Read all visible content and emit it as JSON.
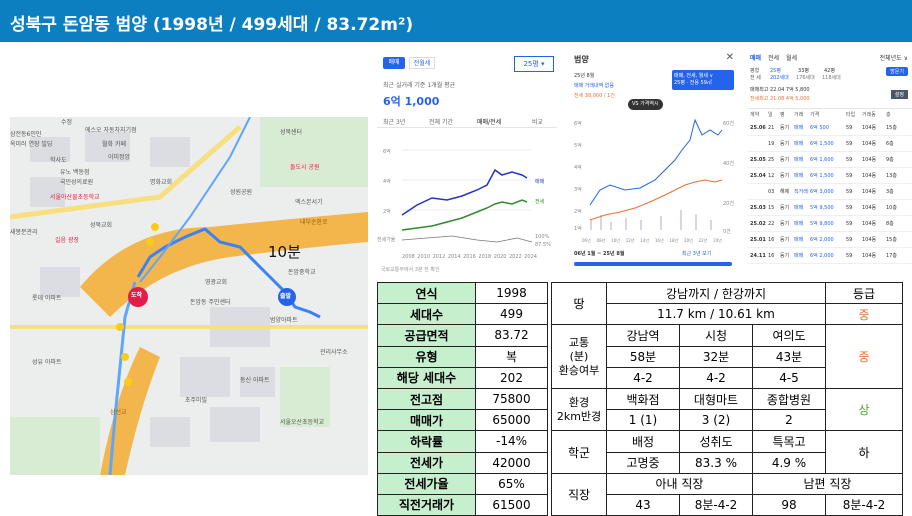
{
  "title": "성북구 돈암동 범양 (1998년 / 499세대 / 83.72m²)",
  "map": {
    "travel_time": "10분",
    "labels": [
      "수정",
      "에스오 자동차지기점",
      "삼전동6인민",
      "옥미러 연장 빌딩",
      "월화 카페",
      "학사도",
      "이미정앙",
      "유노 백동점",
      "국민성의료원",
      "서울아산물초등학교",
      "성북교회",
      "명화교회",
      "성북센터",
      "돌도시 공원",
      "엑스본서기",
      "성원공원",
      "길음서점",
      "길음 광장",
      "새봉분관리",
      "내부순환로",
      "돈암중학교",
      "정릉천",
      "삼선교",
      "미아리 고개",
      "돈암동 주민센터",
      "영광교회",
      "범양아파트",
      "관리사무소",
      "초주미빌",
      "서울오산초등학교",
      "롯데 아파트",
      "성유 아파트",
      "동신 아파트",
      "대성 아파트",
      "국민은행",
      "은신 공원",
      "가정교실",
      "중앙 공원"
    ],
    "pins": [
      "도착",
      "출발"
    ],
    "bus_stops": [
      "1",
      "2",
      "3",
      "4",
      "5"
    ]
  },
  "price_panel": {
    "tabs": [
      "매매",
      "전월세"
    ],
    "area_select": "25평",
    "subtitle": "최근 실거래 기준 1개월 평균",
    "price": "6억 1,000",
    "period_tabs": [
      "최근 3년",
      "전체 기간",
      "매매/전세",
      "비교"
    ],
    "legend": [
      "매매",
      "전세"
    ],
    "x_axis": [
      "2008",
      "2010",
      "2012",
      "2014",
      "2016",
      "2018",
      "2020",
      "2022",
      "2024"
    ],
    "y_axis": [
      "6억",
      "4억",
      "2억"
    ],
    "lower_label": "전세가율",
    "ratio_axis": [
      "100%",
      "87.5%"
    ],
    "footnote": "국토교통부에서 3분 전 확인"
  },
  "trend_panel": {
    "title": "범양",
    "date": "25년 8월",
    "no_trade": "매매 거래내역 없음",
    "jeonse_value": "전세 38,000 / 1건",
    "filter_button": "매매, 전세, 월세 ∨",
    "filter_sub": "25평 · 전용 59㎡",
    "vs_button": "VS 가격역시",
    "y_axis": [
      "6억",
      "5억",
      "4억",
      "3억",
      "2억",
      "1억"
    ],
    "right_axis": [
      "60건",
      "40건",
      "20건",
      "0건"
    ],
    "x_axis": [
      "06년",
      "08년",
      "10년",
      "12년",
      "14년",
      "16년",
      "18년",
      "20년",
      "22년",
      "24년"
    ],
    "range": "06년 1월 ~ 25년 8월",
    "range_link": "최근 3년 보기"
  },
  "list_panel": {
    "tabs": [
      "매매",
      "전세",
      "월세"
    ],
    "all_years": "전체년도 ∨",
    "sizes": [
      "25평",
      "33평",
      "42평"
    ],
    "size_subs": [
      "202세대",
      "176세대",
      "118세대"
    ],
    "row_labels": [
      "평형",
      "전 세"
    ],
    "add_button": "방문기",
    "recent_trade": "매매최고 22.04 7억 5,800",
    "recent_jeonse": "전세최고 21.08 4억 5,000",
    "settings_button": "설정",
    "columns": [
      "계약",
      "일",
      "평",
      "거래",
      "가격",
      "타입",
      "거래동",
      "층"
    ],
    "rows": [
      {
        "ym": "25.06",
        "d": "21",
        "p": "등기",
        "kind": "매매",
        "price": "6억 500",
        "area": "59",
        "dong": "104동",
        "floor": "15층"
      },
      {
        "ym": "",
        "d": "19",
        "p": "등기",
        "kind": "매매",
        "price": "6억 1,500",
        "area": "59",
        "dong": "104동",
        "floor": "6층"
      },
      {
        "ym": "25.05",
        "d": "25",
        "p": "등기",
        "kind": "매매",
        "price": "6억 1,600",
        "area": "59",
        "dong": "104동",
        "floor": "9층"
      },
      {
        "ym": "25.04",
        "d": "12",
        "p": "등기",
        "kind": "매매",
        "price": "6억 1,500",
        "area": "59",
        "dong": "104동",
        "floor": "13층"
      },
      {
        "ym": "",
        "d": "03",
        "p": "해제",
        "kind": "직거래",
        "price": "6억 3,000",
        "area": "59",
        "dong": "104동",
        "floor": "3층"
      },
      {
        "ym": "25.03",
        "d": "15",
        "p": "등기",
        "kind": "매매",
        "price": "5억 9,500",
        "area": "59",
        "dong": "104동",
        "floor": "10층"
      },
      {
        "ym": "25.02",
        "d": "22",
        "p": "등기",
        "kind": "매매",
        "price": "5억 9,800",
        "area": "59",
        "dong": "104동",
        "floor": "8층"
      },
      {
        "ym": "25.01",
        "d": "16",
        "p": "등기",
        "kind": "매매",
        "price": "6억 2,000",
        "area": "59",
        "dong": "104동",
        "floor": "15층"
      },
      {
        "ym": "24.11",
        "d": "16",
        "p": "등기",
        "kind": "매매",
        "price": "6억 2,000",
        "area": "59",
        "dong": "104동",
        "floor": "17층"
      }
    ]
  },
  "spec": [
    {
      "k": "연식",
      "v": "1998"
    },
    {
      "k": "세대수",
      "v": "499"
    },
    {
      "k": "공급면적",
      "v": "83.72"
    },
    {
      "k": "유형",
      "v": "복"
    },
    {
      "k": "해당 세대수",
      "v": "202"
    },
    {
      "k": "전고점",
      "v": "75800"
    },
    {
      "k": "매매가",
      "v": "65000"
    },
    {
      "k": "하락률",
      "v": "-14%"
    },
    {
      "k": "전세가",
      "v": "42000"
    },
    {
      "k": "전세가율",
      "v": "65%"
    },
    {
      "k": "직전거래가",
      "v": "61500"
    }
  ],
  "location": {
    "land_label": "땅",
    "land_header": "강남까지 / 한강까지",
    "grade_header": "등급",
    "land_value": "11.7 km / 10.61 km",
    "land_grade": "중",
    "traffic_label": "교통(분)환승여부",
    "stations": [
      "강남역",
      "시청",
      "여의도"
    ],
    "minutes": [
      "58분",
      "32분",
      "43분"
    ],
    "transfers": [
      "4-2",
      "4-2",
      "4-5"
    ],
    "traffic_grade": "중",
    "env_label": "환경2km반경",
    "env_headers": [
      "백화점",
      "대형마트",
      "종합병원"
    ],
    "env_values": [
      "1 (1)",
      "3 (2)",
      "2"
    ],
    "env_grade": "상",
    "school_label": "학군",
    "school_headers": [
      "배정",
      "성취도",
      "특목고"
    ],
    "school_values": [
      "고명중",
      "83.3 %",
      "4.9 %"
    ],
    "school_grade": "하",
    "job_label": "직장",
    "job_headers": [
      "아내 직장",
      "남편 직장"
    ],
    "job_values": [
      "43",
      "8분-4-2",
      "98",
      "8분-4-2"
    ]
  },
  "colors": {
    "header": "#0c7fc1",
    "spec_key": "#c6efce",
    "mid": "#e97132",
    "high": "#4ea72e",
    "sale_line": "#2234c4",
    "jeonse_line": "#2e8b2e"
  }
}
